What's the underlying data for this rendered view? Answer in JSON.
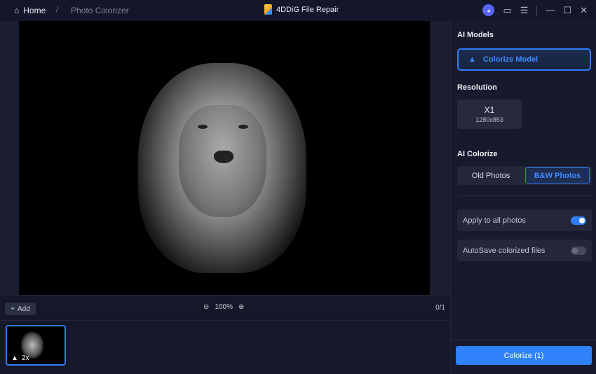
{
  "titlebar": {
    "home": "Home",
    "separator": "/",
    "crumb": "Photo Colorizer",
    "app_title": "4DDiG File Repair"
  },
  "toolbar": {
    "add": "Add",
    "zoom": "100%",
    "counter": "0/1"
  },
  "thumbnail": {
    "label": "2x"
  },
  "panel": {
    "ai_models_heading": "AI Models",
    "model": "Colorize Model",
    "resolution_heading": "Resolution",
    "resolution_scale": "X1",
    "resolution_size": "1280x853",
    "ai_colorize_heading": "AI Colorize",
    "options": [
      "Old Photos",
      "B&W Photos"
    ],
    "apply_all": "Apply to all photos",
    "apply_all_on": true,
    "autosave": "AutoSave colorized files",
    "autosave_on": false,
    "colorize_button": "Colorize (1)"
  },
  "colors": {
    "accent": "#2f7cf6",
    "background": "#151829"
  }
}
